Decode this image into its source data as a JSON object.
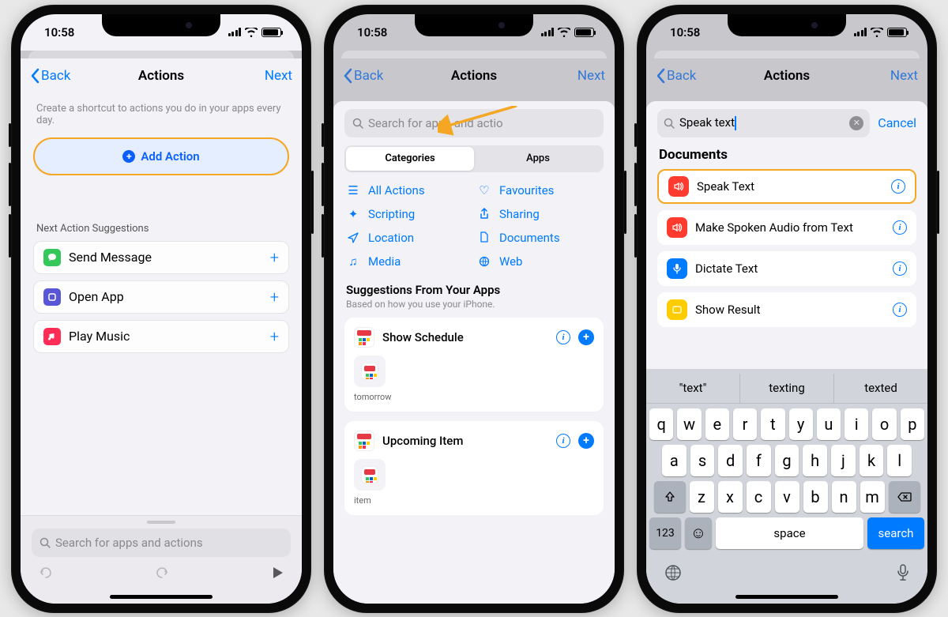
{
  "status": {
    "time": "10:58"
  },
  "nav": {
    "back": "Back",
    "title": "Actions",
    "next": "Next"
  },
  "phone1": {
    "hint": "Create a shortcut to actions you do in your apps every day.",
    "add_action": "Add Action",
    "suggestions_title": "Next Action Suggestions",
    "suggestions": [
      "Send Message",
      "Open App",
      "Play Music"
    ],
    "search_placeholder": "Search for apps and actions"
  },
  "phone2": {
    "search_placeholder": "Search for apps and actio",
    "seg": {
      "categories": "Categories",
      "apps": "Apps"
    },
    "cats": {
      "all": "All Actions",
      "fav": "Favourites",
      "scripting": "Scripting",
      "sharing": "Sharing",
      "location": "Location",
      "documents": "Documents",
      "media": "Media",
      "web": "Web"
    },
    "sugg_title": "Suggestions From Your Apps",
    "sugg_sub": "Based on how you use your iPhone.",
    "cards": [
      {
        "title": "Show Schedule",
        "chip": "tomorrow"
      },
      {
        "title": "Upcoming Item",
        "chip": "item"
      }
    ]
  },
  "phone3": {
    "query": "Speak text",
    "cancel": "Cancel",
    "section": "Documents",
    "results": [
      "Speak Text",
      "Make Spoken Audio from Text",
      "Dictate Text",
      "Show Result"
    ],
    "predictions": [
      "\"text\"",
      "texting",
      "texted"
    ],
    "rows": {
      "r1": [
        "q",
        "w",
        "e",
        "r",
        "t",
        "y",
        "u",
        "i",
        "o",
        "p"
      ],
      "r2": [
        "a",
        "s",
        "d",
        "f",
        "g",
        "h",
        "j",
        "k",
        "l"
      ],
      "r3": [
        "z",
        "x",
        "c",
        "v",
        "b",
        "n",
        "m"
      ]
    },
    "numkey": "123",
    "space": "space",
    "search": "search"
  }
}
